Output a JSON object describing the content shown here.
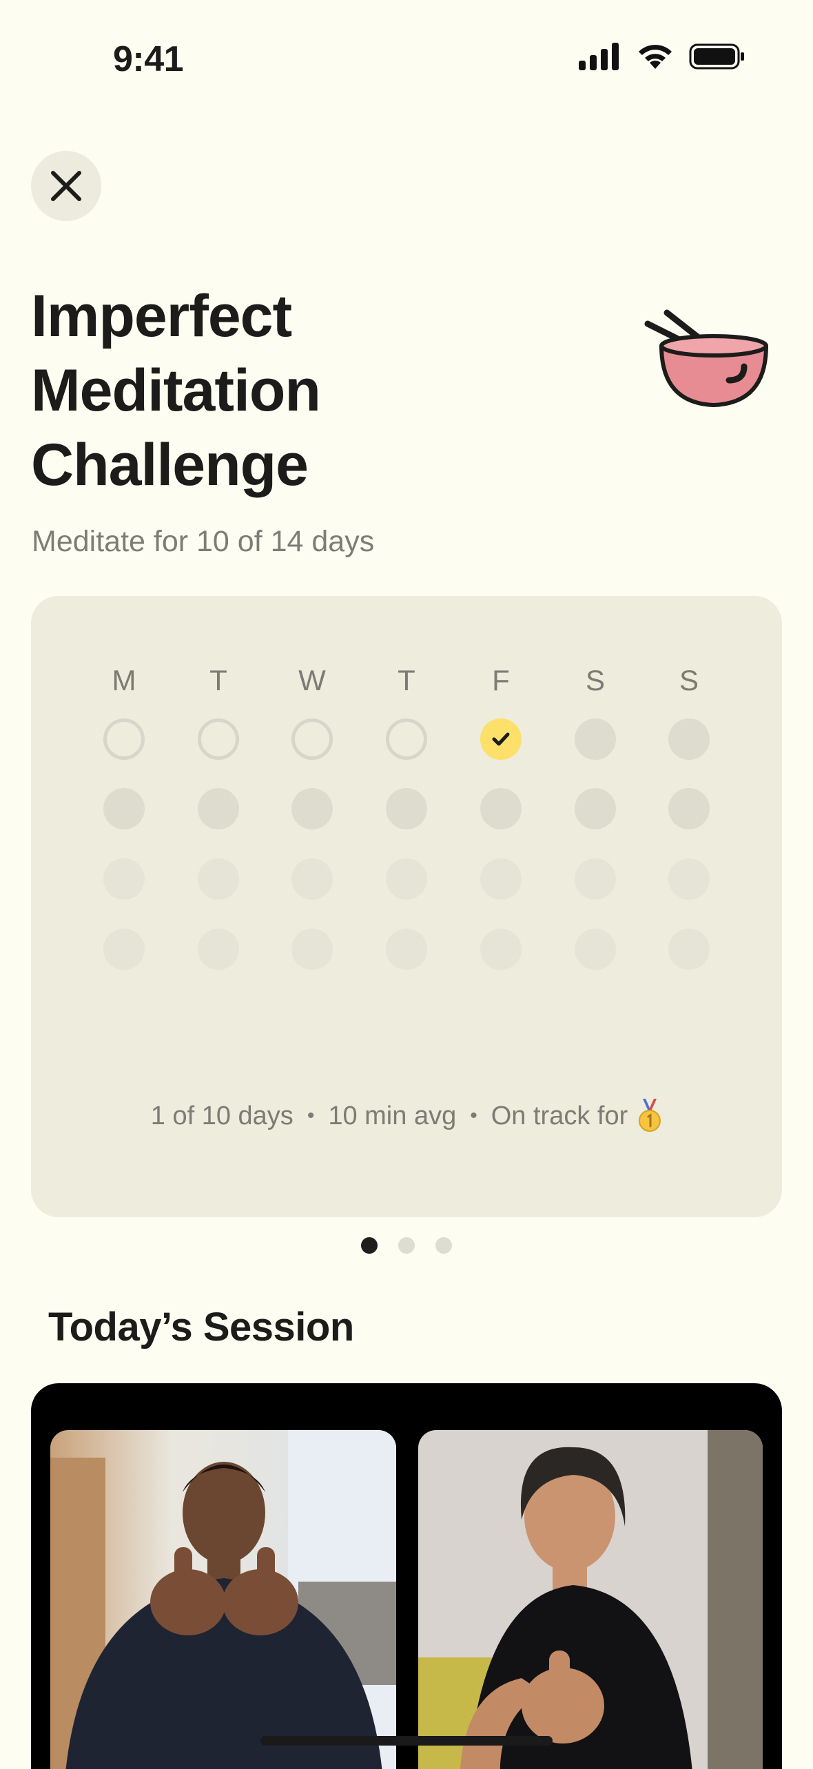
{
  "status_bar": {
    "time": "9:41"
  },
  "header": {
    "close_label": "Close",
    "title_lines": [
      "Imperfect",
      "Meditation",
      "Challenge"
    ],
    "subtitle": "Meditate for 10 of 14 days"
  },
  "calendar": {
    "day_labels": [
      "M",
      "T",
      "W",
      "T",
      "F",
      "S",
      "S"
    ],
    "summary": {
      "days": "1 of 10 days",
      "avg": "10 min avg",
      "track": "On track for",
      "separator": "•"
    }
  },
  "pager": {
    "pages": 3,
    "active": 1
  },
  "today": {
    "section_title": "Today’s Session"
  },
  "colors": {
    "background": "#FEFDF2",
    "card": "#EDECDD",
    "check": "#FCE06A",
    "bowl": "#E88C93"
  }
}
